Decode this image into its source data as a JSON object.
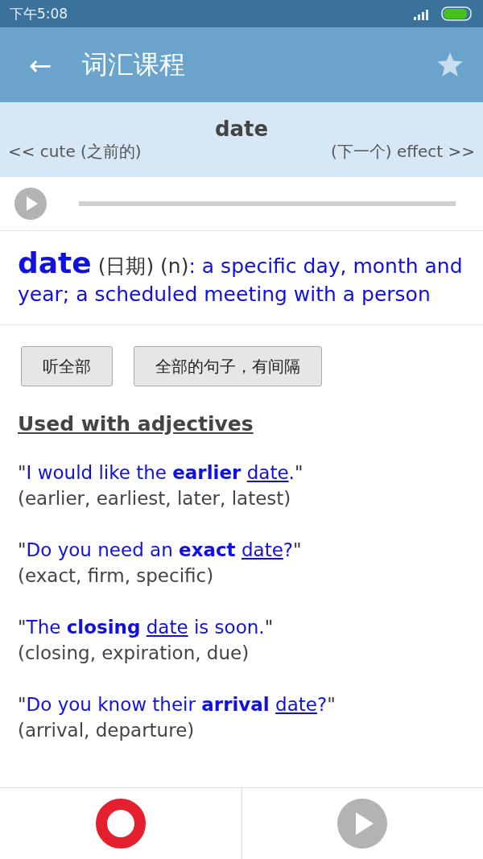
{
  "status_bar": {
    "time": "下午5:08"
  },
  "app_bar": {
    "back": "←",
    "title": "词汇课程",
    "starred": false
  },
  "word_nav": {
    "word": "date",
    "previous": "<< cute (之前的)",
    "next": "(下一个) effect >>"
  },
  "definition": {
    "word": "date",
    "translation": "(日期)",
    "part_of_speech": "(n)",
    "meaning": ": a specific day, month and year; a scheduled meeting with a person"
  },
  "buttons": [
    "听全部",
    "全部的句子，有间隔"
  ],
  "section_title": "Used with adjectives",
  "examples": [
    {
      "open": "\"",
      "before": "I would like the ",
      "keyword": "earlier",
      "link": "date",
      "after": ".",
      "close": "\"",
      "forms": "(earlier, earliest, later, latest)"
    },
    {
      "open": "\"",
      "before": "Do you need an ",
      "keyword": "exact",
      "link": "date",
      "after": "?",
      "close": "\"",
      "forms": "(exact, firm, specific)"
    },
    {
      "open": "\"",
      "before": "The ",
      "keyword": "closing",
      "link": "date",
      "after": " is soon.",
      "close": "\"",
      "forms": "(closing, expiration, due)"
    },
    {
      "open": "\"",
      "before": "Do you know their ",
      "keyword": "arrival",
      "link": "date",
      "after": "?",
      "close": "\"",
      "forms": "(arrival, departure)"
    }
  ],
  "bottom_bar": {
    "recording": false
  }
}
